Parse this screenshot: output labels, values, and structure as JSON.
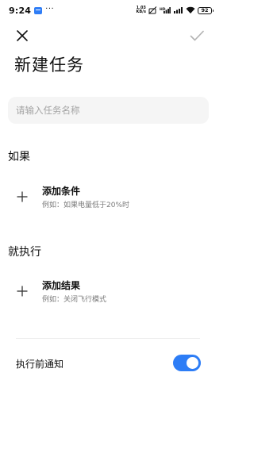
{
  "status_bar": {
    "time": "9:24",
    "more_indicator": "···",
    "net_speed_value": "1.03",
    "net_speed_unit": "KB/s",
    "battery_level": "92",
    "icons": [
      "app-notification-icon",
      "no-sim-icon",
      "signal-hd-icon",
      "signal-icon",
      "wifi-icon",
      "battery-icon"
    ]
  },
  "toolbar": {
    "close_icon": "close-icon",
    "confirm_icon": "checkmark-icon"
  },
  "page": {
    "title": "新建任务"
  },
  "task_name": {
    "value": "",
    "placeholder": "请输入任务名称"
  },
  "if_section": {
    "heading": "如果",
    "add_label": "添加条件",
    "hint": "例如：如果电量低于20%时"
  },
  "then_section": {
    "heading": "就执行",
    "add_label": "添加结果",
    "hint": "例如：关闭飞行模式"
  },
  "notify": {
    "label": "执行前通知",
    "enabled": true
  },
  "colors": {
    "accent": "#2d7df6",
    "input_background": "#f5f5f5",
    "hint_text": "#7a7a7a",
    "placeholder_text": "#a3a3a3",
    "confirm_disabled": "#b3b3b3"
  }
}
